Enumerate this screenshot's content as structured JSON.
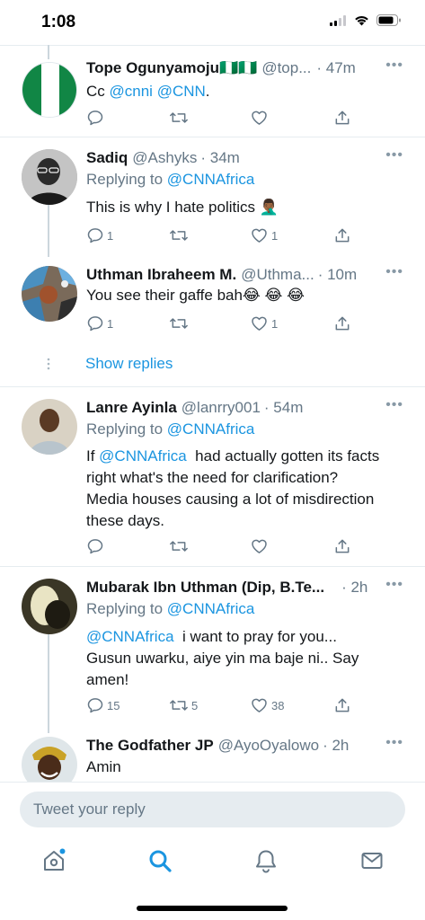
{
  "status": {
    "time": "1:08"
  },
  "tweets": [
    {
      "name": "Tope Ogunyamoju",
      "flags": "🇳🇬🇳🇬",
      "handle": "@top...",
      "time": "· 47m",
      "text_parts": [
        "Cc ",
        "@cnni",
        " ",
        "@CNN",
        "."
      ],
      "counts": {
        "reply": "",
        "retweet": "",
        "like": ""
      }
    },
    {
      "name": "Sadiq",
      "handle": "@Ashyks",
      "time": "· 34m",
      "replying_label": "Replying to",
      "replying_to": "@CNNAfrica",
      "text": "This is why I hate politics 🤦🏾‍♂️",
      "counts": {
        "reply": "1",
        "retweet": "",
        "like": "1"
      }
    },
    {
      "name": "Uthman Ibraheem M.",
      "handle": "@Uthma...",
      "time": "· 10m",
      "text": "You see their gaffe bah😂 😂 😂",
      "counts": {
        "reply": "1",
        "retweet": "",
        "like": "1"
      }
    },
    {
      "name": "Lanre Ayinla",
      "handle": "@lanrry001",
      "time": "· 54m",
      "replying_label": "Replying to",
      "replying_to": "@CNNAfrica",
      "text_mention": "@CNNAfrica",
      "text_rest": "  had actually gotten its facts right what's the need for clarification? Media houses causing a lot of misdirection these days.",
      "text_lead": "If ",
      "counts": {
        "reply": "",
        "retweet": "",
        "like": ""
      }
    },
    {
      "name": "Mubarak Ibn Uthman (Dip, B.Te...",
      "handle": "",
      "time": "· 2h",
      "replying_label": "Replying to",
      "replying_to": "@CNNAfrica",
      "text_mention": "@CNNAfrica",
      "text_rest": "  i want to pray for you... Gusun uwarku, aiye yin ma baje ni.. Say amen!",
      "counts": {
        "reply": "15",
        "retweet": "5",
        "like": "38"
      }
    },
    {
      "name": "The Godfather JP",
      "handle": "@AyoOyalowo",
      "time": "· 2h",
      "text": "Amin"
    }
  ],
  "show_replies": "Show replies",
  "reply_box": {
    "placeholder": "Tweet your reply"
  },
  "colors": {
    "accent": "#1b95e0",
    "muted": "#657786",
    "divider": "#e6ecf0"
  },
  "tabs": [
    "home-icon",
    "search-icon",
    "notifications-icon",
    "messages-icon"
  ]
}
